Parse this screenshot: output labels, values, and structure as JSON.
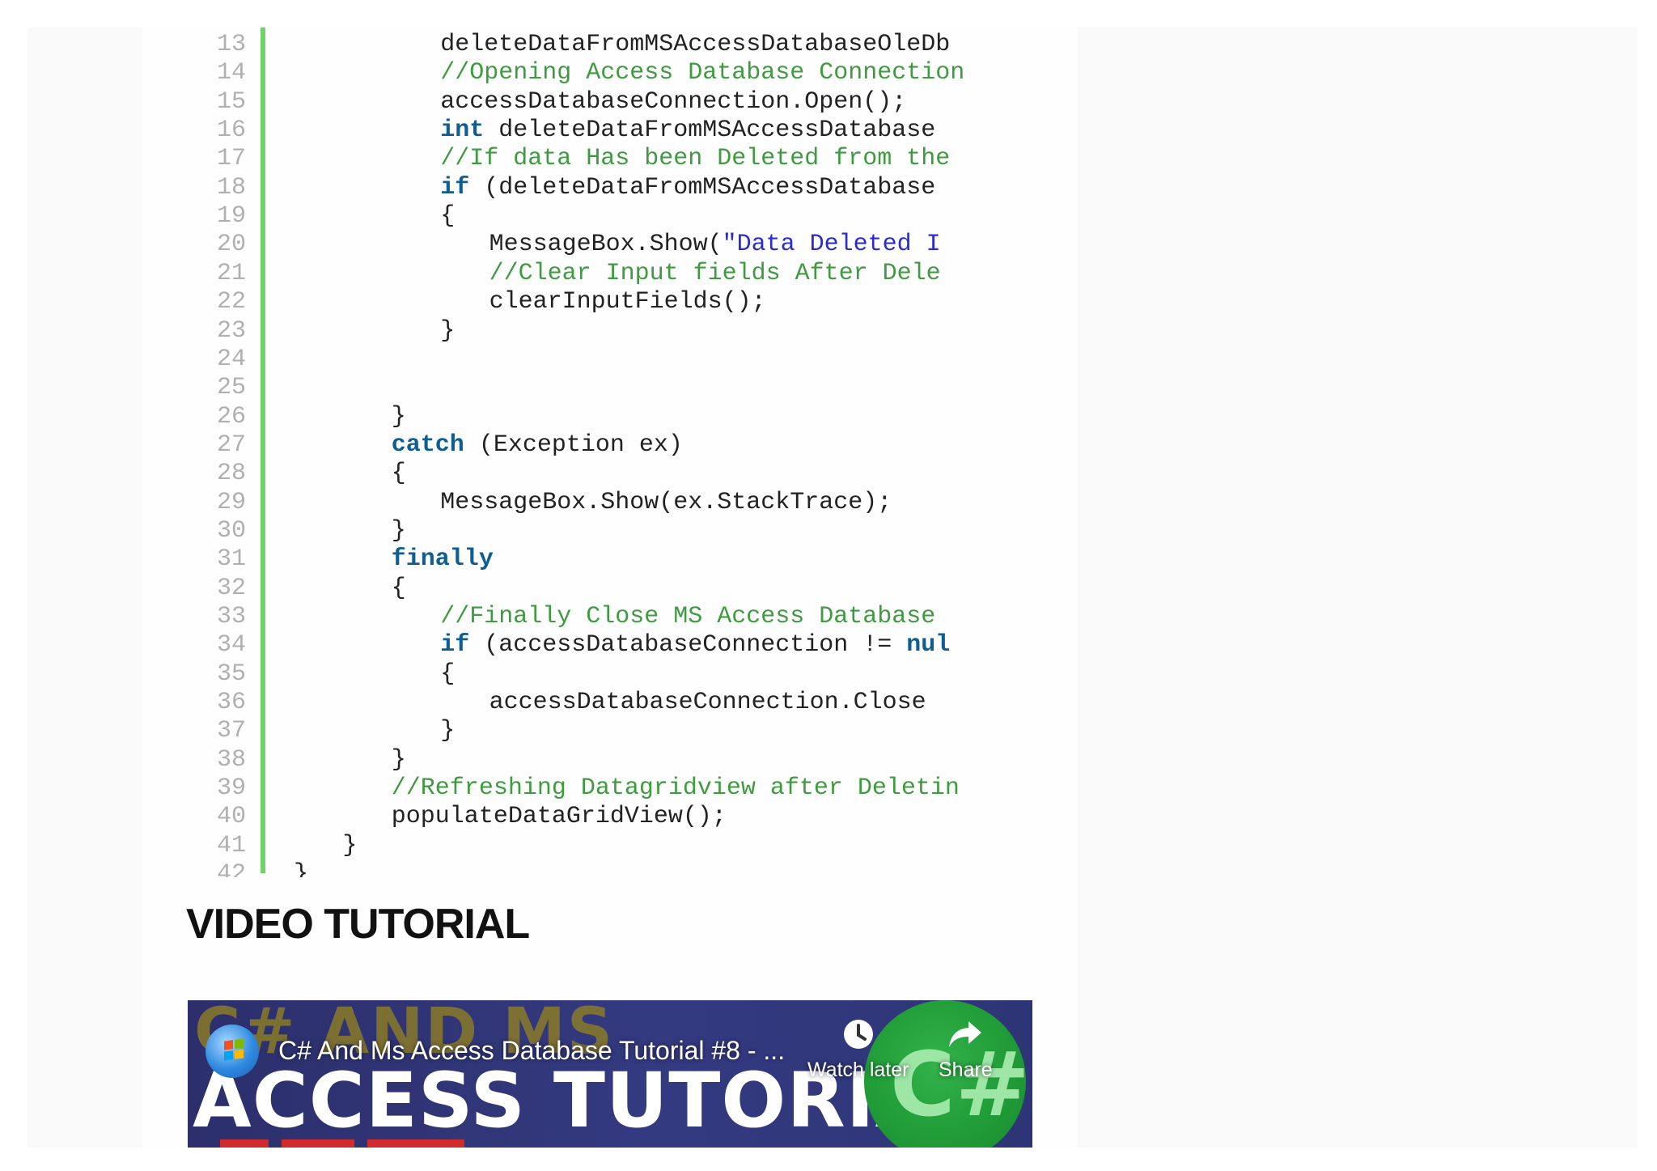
{
  "code": {
    "lines": [
      {
        "n": "13",
        "indent": 12,
        "tokens": [
          {
            "t": "deleteDataFromMSAccessDatabaseOleDb",
            "c": "pl"
          }
        ]
      },
      {
        "n": "14",
        "indent": 12,
        "tokens": [
          {
            "t": "//Opening Access Database Connection",
            "c": "cm"
          }
        ]
      },
      {
        "n": "15",
        "indent": 12,
        "tokens": [
          {
            "t": "accessDatabaseConnection.Open();",
            "c": "pl"
          }
        ]
      },
      {
        "n": "16",
        "indent": 12,
        "tokens": [
          {
            "t": "int",
            "c": "kw"
          },
          {
            "t": " deleteDataFromMSAccessDatabase",
            "c": "pl"
          }
        ]
      },
      {
        "n": "17",
        "indent": 12,
        "tokens": [
          {
            "t": "//If data Has been Deleted from the",
            "c": "cm"
          }
        ]
      },
      {
        "n": "18",
        "indent": 12,
        "tokens": [
          {
            "t": "if",
            "c": "kw"
          },
          {
            "t": " (deleteDataFromMSAccessDatabase",
            "c": "pl"
          }
        ]
      },
      {
        "n": "19",
        "indent": 12,
        "tokens": [
          {
            "t": "{",
            "c": "pl"
          }
        ]
      },
      {
        "n": "20",
        "indent": 16,
        "tokens": [
          {
            "t": "MessageBox.Show(",
            "c": "pl"
          },
          {
            "t": "\"Data Deleted I",
            "c": "st"
          }
        ]
      },
      {
        "n": "21",
        "indent": 16,
        "tokens": [
          {
            "t": "//Clear Input fields After Dele",
            "c": "cm"
          }
        ]
      },
      {
        "n": "22",
        "indent": 16,
        "tokens": [
          {
            "t": "clearInputFields();",
            "c": "pl"
          }
        ]
      },
      {
        "n": "23",
        "indent": 12,
        "tokens": [
          {
            "t": "}",
            "c": "pl"
          }
        ]
      },
      {
        "n": "24",
        "indent": 0,
        "tokens": []
      },
      {
        "n": "25",
        "indent": 0,
        "tokens": []
      },
      {
        "n": "26",
        "indent": 8,
        "tokens": [
          {
            "t": "}",
            "c": "pl"
          }
        ]
      },
      {
        "n": "27",
        "indent": 8,
        "tokens": [
          {
            "t": "catch",
            "c": "kw"
          },
          {
            "t": " (Exception ex)",
            "c": "pl"
          }
        ]
      },
      {
        "n": "28",
        "indent": 8,
        "tokens": [
          {
            "t": "{",
            "c": "pl"
          }
        ]
      },
      {
        "n": "29",
        "indent": 12,
        "tokens": [
          {
            "t": "MessageBox.Show(ex.StackTrace);",
            "c": "pl"
          }
        ]
      },
      {
        "n": "30",
        "indent": 8,
        "tokens": [
          {
            "t": "}",
            "c": "pl"
          }
        ]
      },
      {
        "n": "31",
        "indent": 8,
        "tokens": [
          {
            "t": "finally",
            "c": "kw"
          }
        ]
      },
      {
        "n": "32",
        "indent": 8,
        "tokens": [
          {
            "t": "{",
            "c": "pl"
          }
        ]
      },
      {
        "n": "33",
        "indent": 12,
        "tokens": [
          {
            "t": "//Finally Close MS Access Database",
            "c": "cm"
          }
        ]
      },
      {
        "n": "34",
        "indent": 12,
        "tokens": [
          {
            "t": "if",
            "c": "kw"
          },
          {
            "t": " (accessDatabaseConnection != ",
            "c": "pl"
          },
          {
            "t": "nul",
            "c": "kw"
          }
        ]
      },
      {
        "n": "35",
        "indent": 12,
        "tokens": [
          {
            "t": "{",
            "c": "pl"
          }
        ]
      },
      {
        "n": "36",
        "indent": 16,
        "tokens": [
          {
            "t": "accessDatabaseConnection.Close",
            "c": "pl"
          }
        ]
      },
      {
        "n": "37",
        "indent": 12,
        "tokens": [
          {
            "t": "}",
            "c": "pl"
          }
        ]
      },
      {
        "n": "38",
        "indent": 8,
        "tokens": [
          {
            "t": "}",
            "c": "pl"
          }
        ]
      },
      {
        "n": "39",
        "indent": 8,
        "tokens": [
          {
            "t": "//Refreshing Datagridview after Deletin",
            "c": "cm"
          }
        ]
      },
      {
        "n": "40",
        "indent": 8,
        "tokens": [
          {
            "t": "populateDataGridView();",
            "c": "pl"
          }
        ]
      },
      {
        "n": "41",
        "indent": 4,
        "tokens": [
          {
            "t": "}",
            "c": "pl"
          }
        ]
      },
      {
        "n": "42",
        "indent": 0,
        "tokens": [
          {
            "t": "}",
            "c": "pl"
          }
        ]
      }
    ]
  },
  "section_title": "VIDEO TUTORIAL",
  "video": {
    "thumbnail_line1": "C# AND MS",
    "thumbnail_line2": "ACCESS TUTORIAL",
    "logo_text": "C#",
    "title": "C# And Ms Access Database Tutorial #8 - ...",
    "watch_later_label": "Watch later",
    "share_label": "Share",
    "channel_icon": "windows-logo-icon",
    "watch_later_icon": "clock-icon",
    "share_icon": "share-arrow-icon"
  },
  "colors": {
    "keyword": "#0e5e91",
    "comment": "#3f9b3f",
    "string": "#2b2bd6",
    "gutter_bar": "#6fd36a",
    "line_number": "#b0b0b0"
  }
}
